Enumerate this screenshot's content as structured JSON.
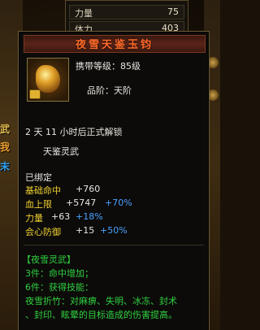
{
  "background": {
    "stats": [
      {
        "label": "力量",
        "value": "75"
      },
      {
        "label": "体力",
        "value": "403"
      }
    ],
    "left_tags": [
      "武",
      "我",
      "末"
    ]
  },
  "item": {
    "name": "夜雪天鉴玉钧",
    "carry_level": "携带等级：85级",
    "grade": "品阶：天阶",
    "unlock_note": "2 天 11 小时后正式解锁",
    "category": "天鉴灵武",
    "bound": "已绑定",
    "stats": [
      {
        "label": "基础命中",
        "base": "+760",
        "extra": ""
      },
      {
        "label": "血上限",
        "base": "+5747",
        "extra": "+70%"
      },
      {
        "label": "力量",
        "base": "+63",
        "extra": "+18%"
      },
      {
        "label": "会心防御",
        "base": "+15",
        "extra": "+50%"
      }
    ],
    "set_name": "【夜雪灵武】",
    "set_3": "3件：命中增加；",
    "set_6": "6件：获得技能：",
    "skill_line1": "夜雪折竹：对麻痹、失明、冰冻、封术",
    "skill_line2": "、封印、眩晕的目标造成的伤害提高。"
  },
  "colors": {
    "title": "#ff6a2a",
    "blue_bonus": "#4aa0ff",
    "set_green": "#30d040",
    "category_yellow": "#f0d030"
  }
}
